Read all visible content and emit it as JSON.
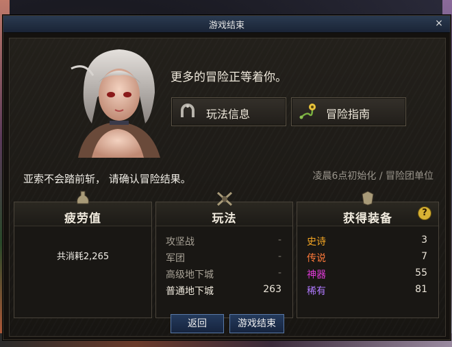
{
  "window": {
    "title": "游戏结束",
    "close_symbol": "×"
  },
  "headline": "更多的冒险正等着你。",
  "buttons": {
    "play_info": "玩法信息",
    "adventure_guide": "冒险指南",
    "return": "返回",
    "end_game": "游戏结束"
  },
  "warning": "亚索不会踏前斩， 请确认冒险结果。",
  "reset_note": "凌晨6点初始化 / 冒险团单位",
  "fatigue": {
    "title": "疲劳值",
    "text": "共消耗2,265"
  },
  "modes": {
    "title": "玩法",
    "rows": [
      {
        "name": "攻坚战",
        "value": "-"
      },
      {
        "name": "军团",
        "value": "-"
      },
      {
        "name": "高级地下城",
        "value": "-"
      },
      {
        "name": "普通地下城",
        "value": "263"
      }
    ]
  },
  "equipment": {
    "title": "获得装备",
    "help": "?",
    "rows": [
      {
        "name": "史诗",
        "value": "3",
        "color": "#f5a623"
      },
      {
        "name": "传说",
        "value": "7",
        "color": "#ff7a3a"
      },
      {
        "name": "神器",
        "value": "55",
        "color": "#e03ad8"
      },
      {
        "name": "稀有",
        "value": "81",
        "color": "#b07aff"
      }
    ]
  },
  "colors": {
    "title_bar": "#1a2436",
    "panel": "#1d1a16",
    "button_blue": "#1e3050"
  }
}
